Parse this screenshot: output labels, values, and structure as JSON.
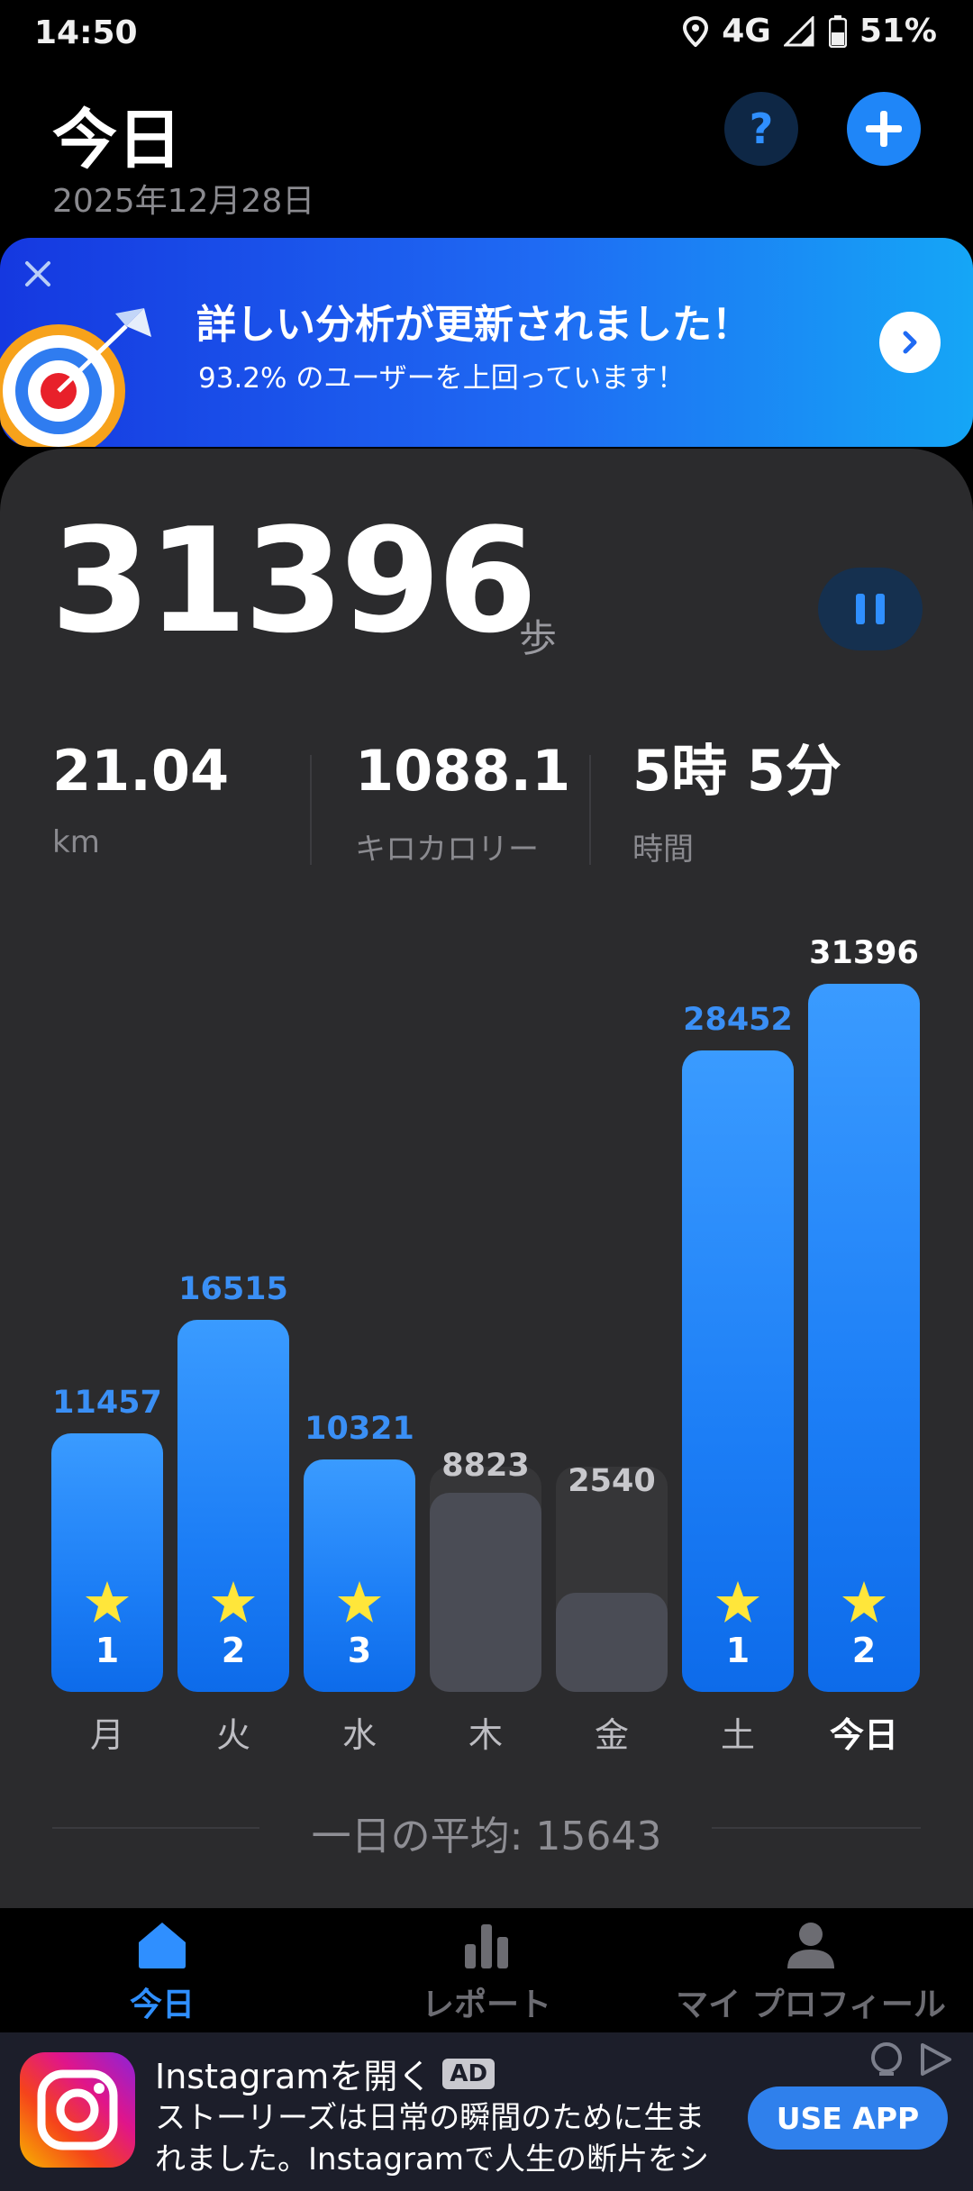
{
  "status_bar": {
    "time": "14:50",
    "network": "4G",
    "battery": "51%"
  },
  "header": {
    "title": "今日",
    "date": "2025年12月28日",
    "help_label": "?"
  },
  "banner": {
    "title": "詳しい分析が更新されました！",
    "subtitle": "93.2% のユーザーを上回っています！"
  },
  "today": {
    "steps": "31396",
    "steps_unit": "歩",
    "stats": [
      {
        "value": "21.04",
        "label": "km"
      },
      {
        "value": "1088.1",
        "label": "キロカロリー"
      },
      {
        "value": "5時 5分",
        "label": "時間"
      }
    ]
  },
  "chart_data": {
    "type": "bar",
    "categories": [
      "月",
      "火",
      "水",
      "木",
      "金",
      "土",
      "今日"
    ],
    "values": [
      11457,
      16515,
      10321,
      8823,
      2540,
      28452,
      31396
    ],
    "goal": 10000,
    "goal_met": [
      true,
      true,
      true,
      false,
      false,
      true,
      true
    ],
    "star_counts": [
      "1",
      "2",
      "3",
      "",
      "",
      "1",
      "2"
    ],
    "value_labels": [
      "11457",
      "16515",
      "10321",
      "8823",
      "2540",
      "28452",
      "31396"
    ],
    "ylim": [
      0,
      31396
    ],
    "colors": {
      "met": "#1f86f8",
      "missed": "#4a4c55",
      "label_met": "#3a8ff5",
      "label_missed": "#c8c8cc",
      "label_today": "#ffffff"
    }
  },
  "average": {
    "text": "一日の平均: 15643"
  },
  "nav": {
    "items": [
      {
        "label": "今日",
        "icon": "home-icon",
        "active": true
      },
      {
        "label": "レポート",
        "icon": "bar-chart-icon",
        "active": false
      },
      {
        "label": "マイ プロフィール",
        "icon": "person-icon",
        "active": false
      }
    ]
  },
  "ad": {
    "title": "Instagramを開く",
    "badge": "AD",
    "body": "ストーリーズは日常の瞬間のために生まれました。Instagramで人生の断片をシェ…",
    "button": "USE APP"
  }
}
